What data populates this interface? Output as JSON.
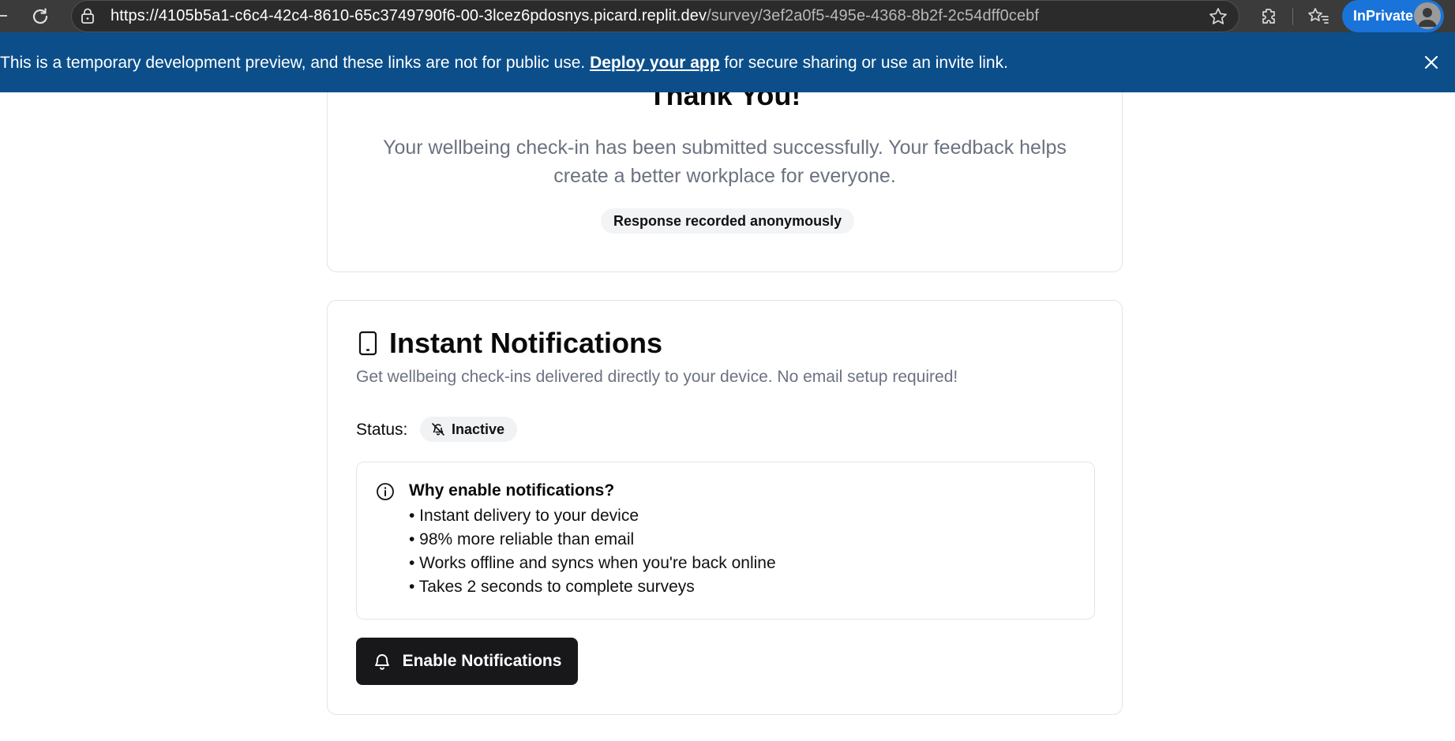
{
  "browser": {
    "url_host": "https://4105b5a1-c6c4-42c4-8610-65c3749790f6-00-3lcez6pdosnys.picard.replit.dev",
    "url_path": "/survey/3ef2a0f5-495e-4368-8b2f-2c54dff0cebf",
    "inprivate_label": "InPrivate",
    "icons": [
      "reload-icon",
      "lock-icon",
      "star-icon",
      "extensions-icon",
      "favorites-icon",
      "avatar"
    ]
  },
  "dev_banner": {
    "text_before": "This is a temporary development preview, and these links are not for public use. ",
    "link_label": "Deploy your app",
    "text_after": " for secure sharing or use an invite link.",
    "background": "#0b4e8a"
  },
  "thanks_card": {
    "title": "Thank You!",
    "message": "Your wellbeing check-in has been submitted successfully. Your feedback helps create a better workplace for everyone.",
    "badge": "Response recorded anonymously"
  },
  "notifications_card": {
    "title": "Instant Notifications",
    "title_icon": "smartphone-icon",
    "description": "Get wellbeing check-ins delivered directly to your device. No email setup required!",
    "status_label": "Status:",
    "status_value": "Inactive",
    "status_icon": "bell-off-icon",
    "info": {
      "title": "Why enable notifications?",
      "icon": "info-icon",
      "items": [
        "• Instant delivery to your device",
        "• 98% more reliable than email",
        "• Works offline and syncs when you're back online",
        "• Takes 2 seconds to complete surveys"
      ]
    },
    "button_label": "Enable Notifications",
    "button_icon": "bell-icon",
    "button_color": "#18181b"
  }
}
